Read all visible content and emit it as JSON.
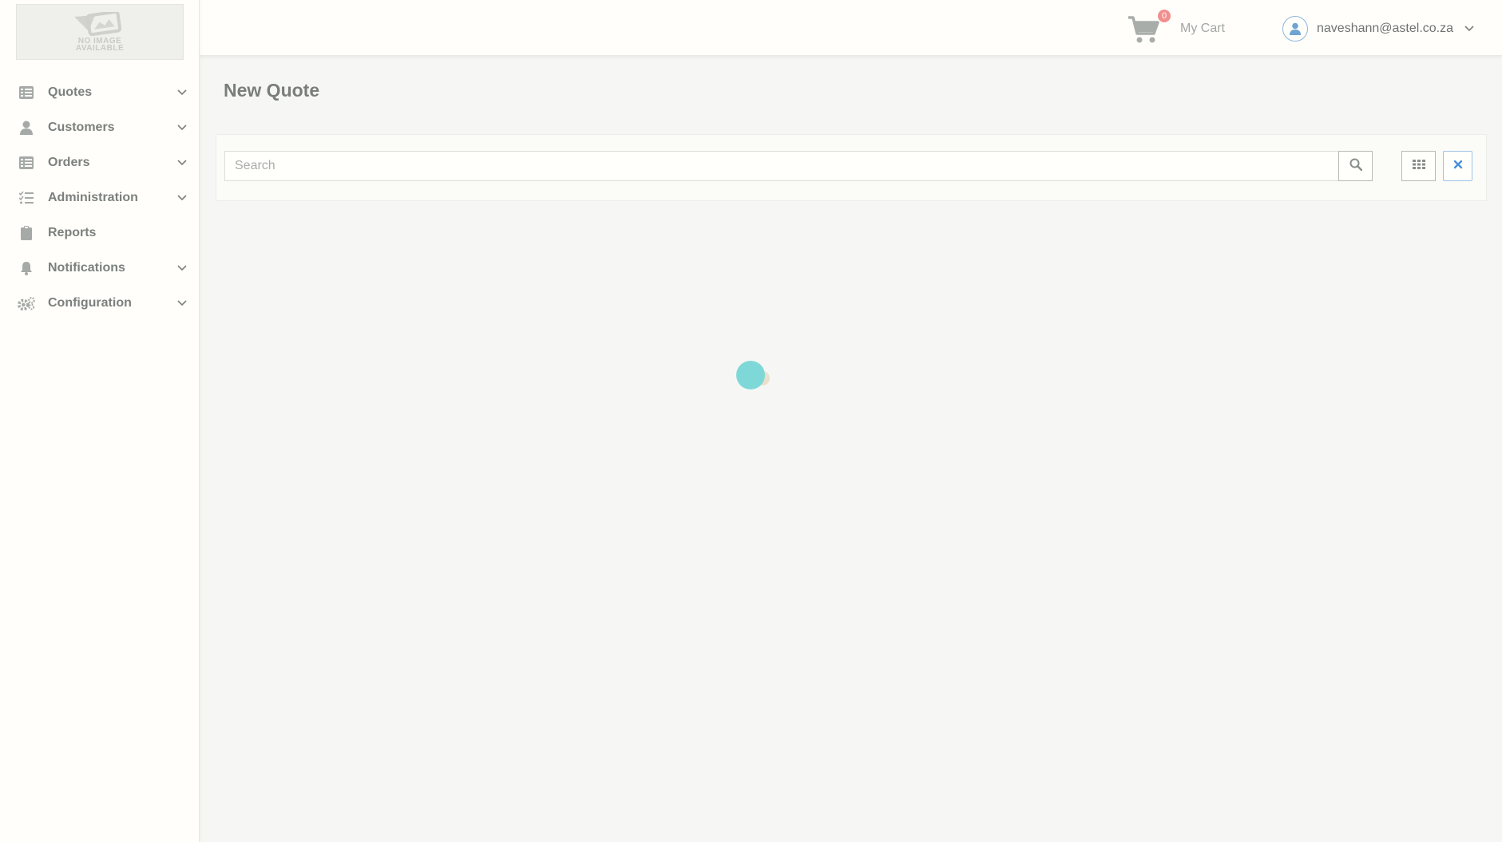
{
  "logo": {
    "text_line1": "NO IMAGE",
    "text_line2": "AVAILABLE"
  },
  "sidebar": {
    "items": [
      {
        "label": "Quotes",
        "icon": "list-icon",
        "has_chevron": true
      },
      {
        "label": "Customers",
        "icon": "user-icon",
        "has_chevron": true
      },
      {
        "label": "Orders",
        "icon": "list-icon",
        "has_chevron": true
      },
      {
        "label": "Administration",
        "icon": "tasks-icon",
        "has_chevron": true
      },
      {
        "label": "Reports",
        "icon": "clipboard-icon",
        "has_chevron": false
      },
      {
        "label": "Notifications",
        "icon": "bell-icon",
        "has_chevron": true
      },
      {
        "label": "Configuration",
        "icon": "cogs-icon",
        "has_chevron": true
      }
    ]
  },
  "header": {
    "cart_count": "0",
    "cart_label": "My Cart",
    "user_email": "naveshann@astel.co.za"
  },
  "main": {
    "title": "New Quote",
    "search": {
      "placeholder": "Search",
      "value": ""
    }
  },
  "colors": {
    "cart_badge": "#f18e8e",
    "loader_primary": "#7fd8d8",
    "accent_blue": "#4a90d9"
  }
}
